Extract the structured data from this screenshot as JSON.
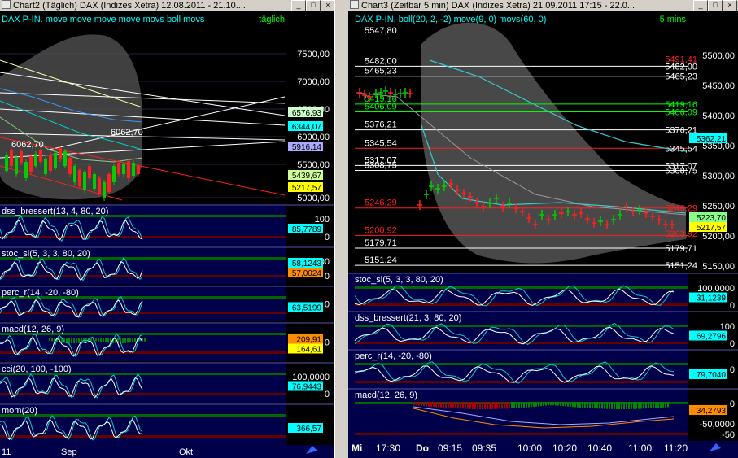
{
  "chart2": {
    "title": "Chart2 (Täglich)  DAX (Indizes Xetra) 12.08.2011 - 21.10....",
    "header": "DAX P-IN. move move move move movs boll movs",
    "interval": "täglich",
    "price_ticks": [
      "7500,00",
      "7000,00",
      "6500,00",
      "6000,00",
      "5500,00",
      "5000,00"
    ],
    "badges": [
      "6576,93",
      "6344,07",
      "5916,14",
      "5439,67",
      "5217,57"
    ],
    "price_labels": [
      "6062,70",
      "6062,70"
    ],
    "panels": [
      {
        "name": "dss_bressert(13, 4, 80, 20)",
        "ticks": [
          "100",
          "0"
        ],
        "badge": "85,7789"
      },
      {
        "name": "stoc_sl(5, 3, 3, 80, 20)",
        "ticks": [
          "100",
          "0"
        ],
        "badge": "58,1243",
        "badge2": "57,0024"
      },
      {
        "name": "perc_r(14, -20, -80)",
        "ticks": [
          "0"
        ],
        "badge": "63,5199"
      },
      {
        "name": "macd(12, 26, 9)",
        "ticks": [
          "0"
        ],
        "badge": "209,91",
        "badge2": "164,61"
      },
      {
        "name": "cci(20, 100, -100)",
        "ticks": [
          "100,0000",
          "0"
        ],
        "badge": "76,9443"
      },
      {
        "name": "mom(20)",
        "ticks": [],
        "badge": "366,57"
      }
    ],
    "xaxis": [
      "11",
      "Sep",
      "Okt"
    ]
  },
  "chart3": {
    "title": "Chart3 (Zeitbar 5 min)  DAX (Indizes Xetra) 21.09.2011 17:15 - 22.0...",
    "header": "DAX P-IN. boll(20, 2, -2) move(9, 0) movs(60, 0)",
    "interval": "5 mins",
    "price_ticks": [
      "5500,00",
      "5450,00",
      "5400,00",
      "5350,00",
      "5300,00",
      "5250,00",
      "5200,00",
      "5150,00"
    ],
    "level_labels_left": [
      "5547,80",
      "5482,00",
      "5465,23",
      "5419,16",
      "5406,09",
      "5376,21",
      "5345,54",
      "5317,07",
      "5308,75",
      "5246,29",
      "5200,92",
      "5179,71",
      "5151,24"
    ],
    "level_labels_right": [
      "5491,41",
      "5482,00",
      "5465,23",
      "5419,16",
      "5406,09",
      "5376,21",
      "5345,54",
      "5317,07",
      "5308,75",
      "5246,29",
      "5203,92",
      "5179,71",
      "5151,24"
    ],
    "badges": [
      "5362,21",
      "5223,70",
      "5217,57"
    ],
    "panels": [
      {
        "name": "stoc_sl(5, 3, 3, 80, 20)",
        "ticks": [
          "100,0000",
          "0"
        ],
        "badge": "31,1239"
      },
      {
        "name": "dss_bressert(21, 3, 80, 20)",
        "ticks": [
          "100",
          "0"
        ],
        "badge": "69,2796"
      },
      {
        "name": "perc_r(14, -20, -80)",
        "ticks": [
          "0"
        ],
        "badge": "79,7040"
      },
      {
        "name": "macd(12, 26, 9)",
        "ticks": [
          "0",
          "-50"
        ],
        "badge": "34,2793",
        "badge2": "-50,0000"
      }
    ],
    "xaxis": [
      "Mi",
      "17:30",
      "Do",
      "09:15",
      "09:35",
      "10:00",
      "10:20",
      "10:40",
      "11:00",
      "11:20"
    ]
  },
  "colors": {
    "bg": "#000000",
    "panel_bg": "#00004a",
    "grid": "#1c1c4a",
    "badge_cyan": "#00ffff",
    "badge_yellow": "#ffff00",
    "badge_orange": "#ff8c00"
  }
}
